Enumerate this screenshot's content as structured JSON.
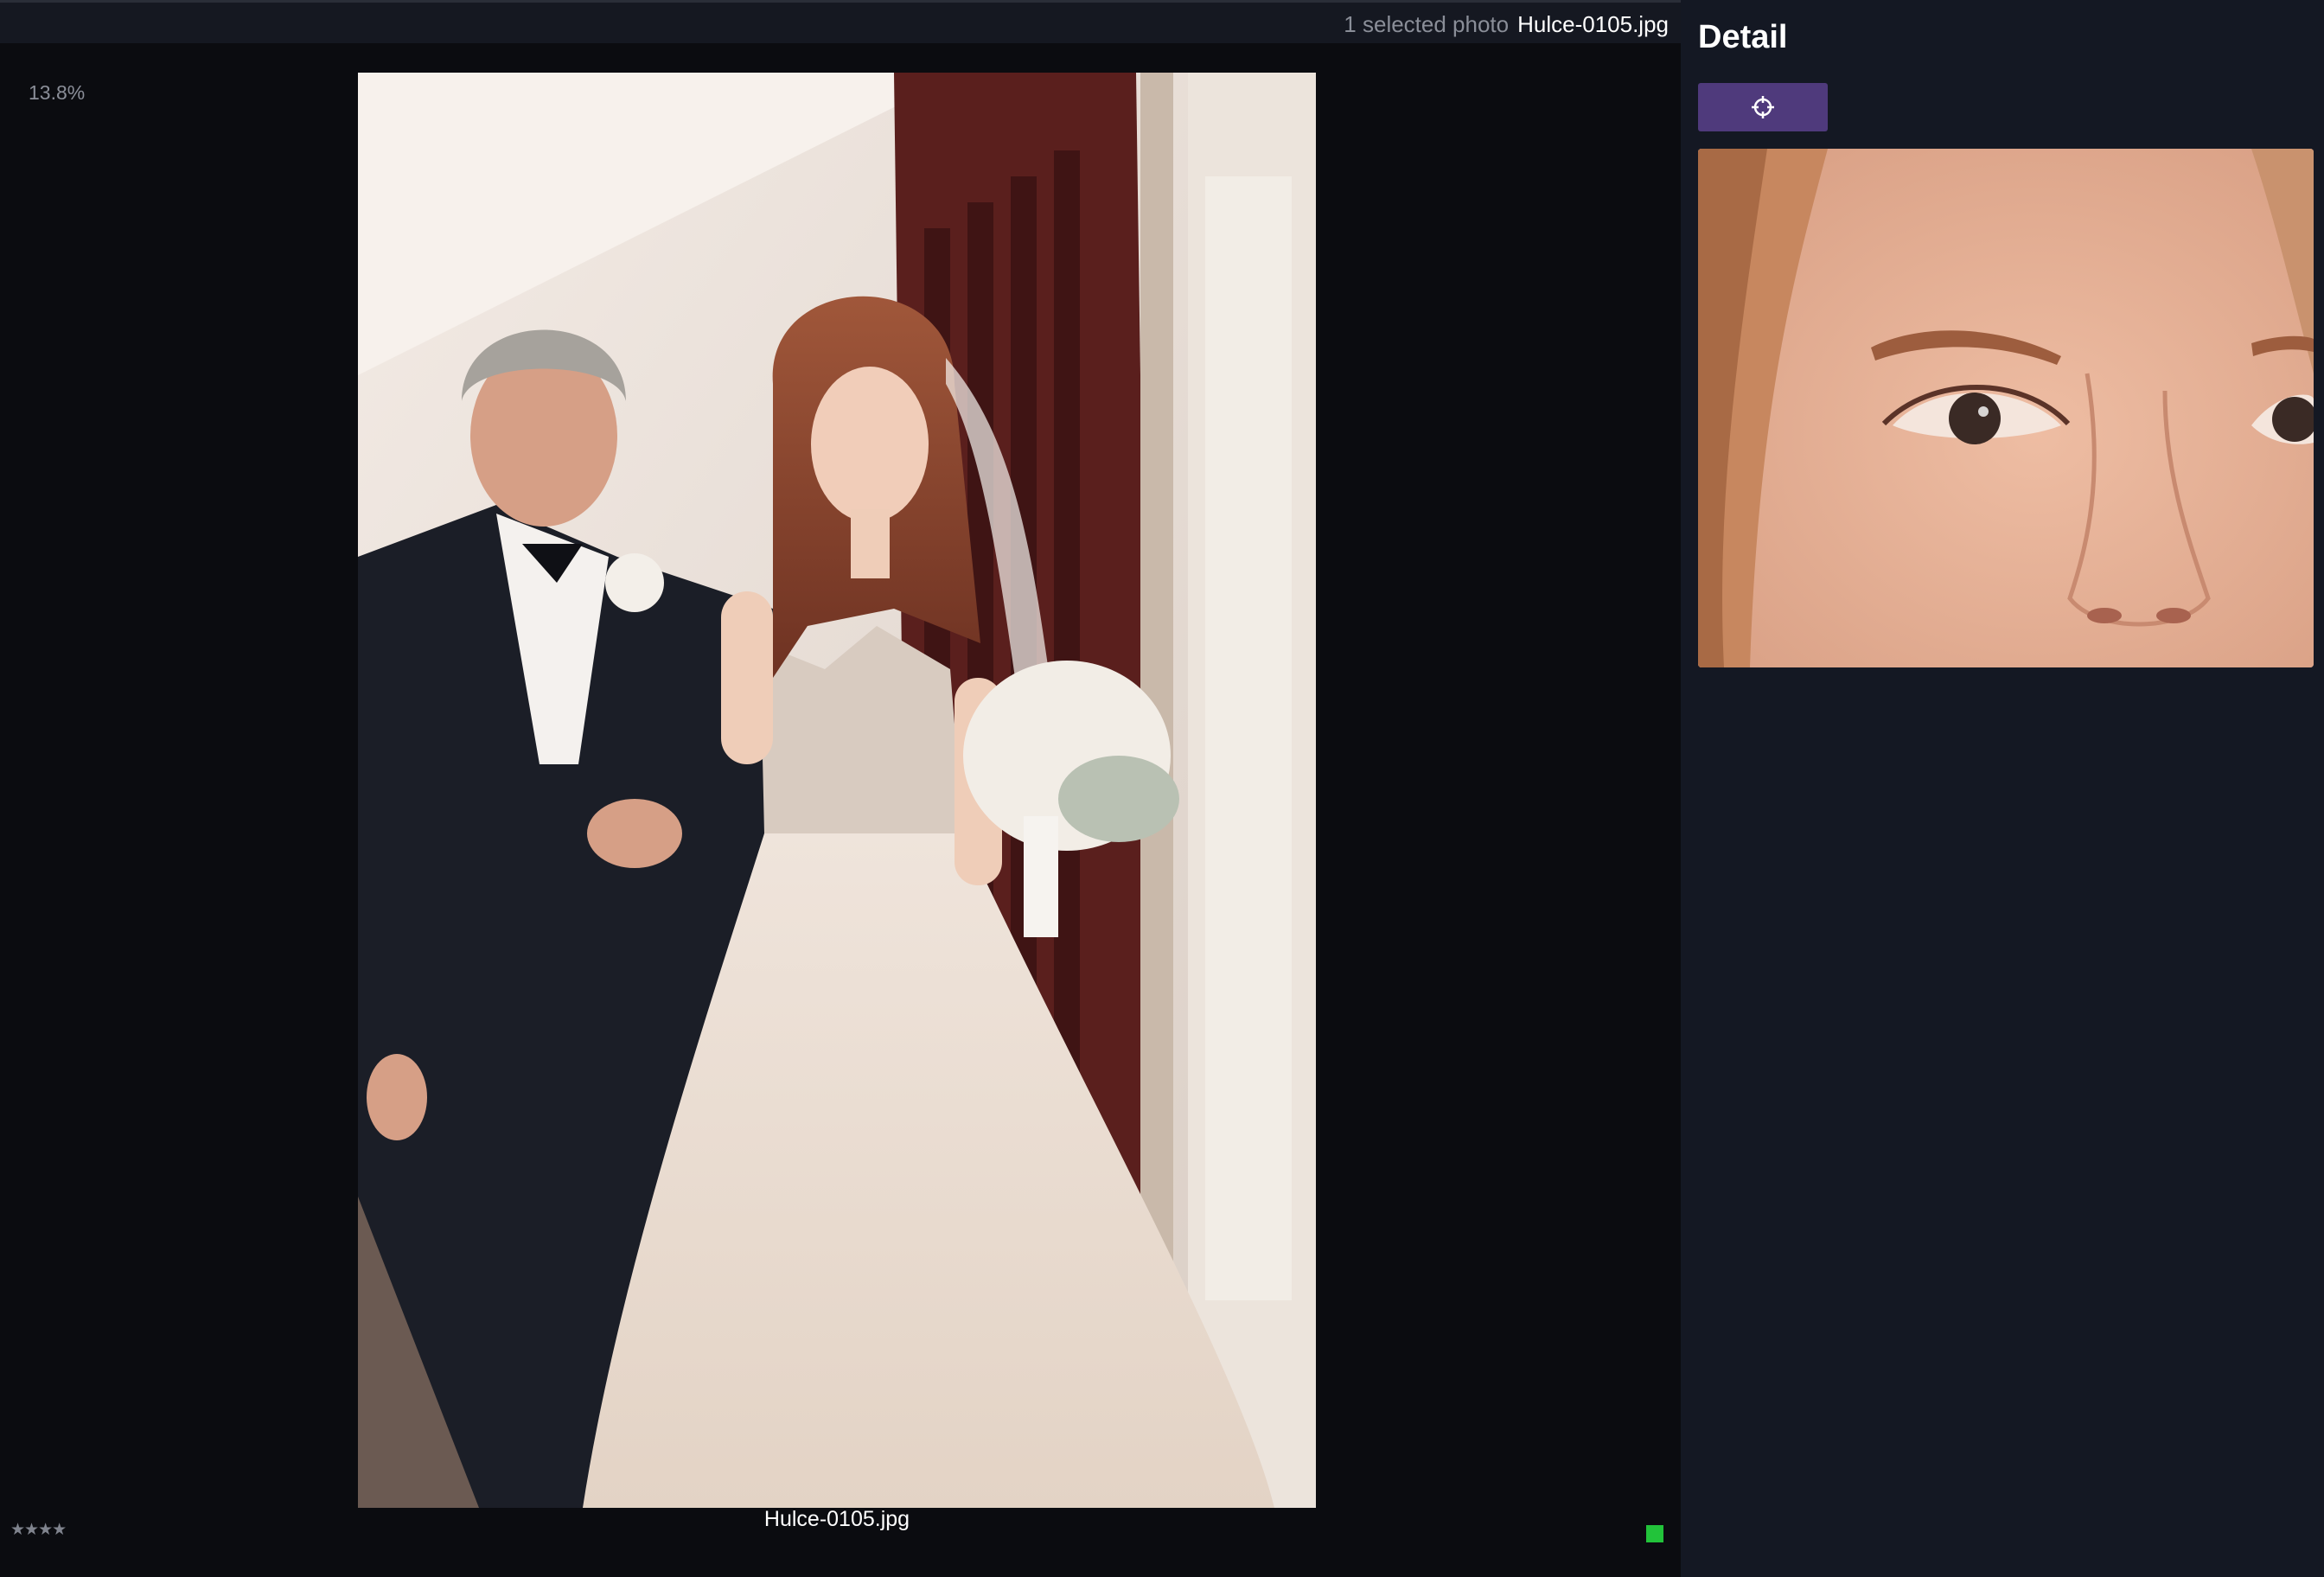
{
  "header": {
    "selection_count": "1 selected photo",
    "selected_filename": "Hulce-0105.jpg"
  },
  "viewer": {
    "zoom_level": "13.8%",
    "caption": "Hulce-0105.jpg",
    "rating": 4,
    "rating_stars": "★★★★",
    "color_label": "#22c33a"
  },
  "detail_panel": {
    "title": "Detail",
    "focus_button_icon": "crosshair-icon"
  },
  "colors": {
    "accent": "#4f3a7c",
    "panel_bg": "#141823",
    "viewer_bg": "#0b0c10"
  }
}
